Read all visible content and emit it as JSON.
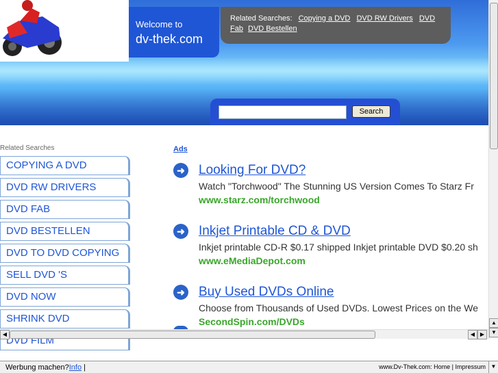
{
  "header": {
    "welcome_line1": "Welcome to",
    "welcome_line2": "dv-thek.com",
    "related_label": "Related Searches:",
    "related_links": [
      "Copying a DVD",
      "DVD RW Drivers",
      "DVD Fab",
      "DVD Bestellen"
    ],
    "search_button": "Search",
    "search_value": ""
  },
  "left": {
    "heading": "Related Searches",
    "items": [
      "COPYING A DVD",
      "DVD RW DRIVERS",
      "DVD FAB",
      "DVD BESTELLEN",
      "DVD TO DVD COPYING",
      "SELL DVD 'S",
      "DVD NOW",
      "SHRINK DVD",
      "DVD FILM"
    ]
  },
  "ads": {
    "label": "Ads",
    "items": [
      {
        "title": "Looking For DVD?",
        "desc": "Watch \"Torchwood\" The Stunning US Version Comes To Starz Fr",
        "url": "www.starz.com/torchwood"
      },
      {
        "title": "Inkjet Printable CD & DVD",
        "desc": "Inkjet printable CD-R $0.17 shipped Inkjet printable DVD $0.20 sh",
        "url": "www.eMediaDepot.com"
      },
      {
        "title": "Buy Used DVDs Online",
        "desc": "Choose from Thousands of Used DVDs. Lowest Prices on the We",
        "url": "SecondSpin.com/DVDs"
      }
    ]
  },
  "status": {
    "ad_text": "Werbung machen?",
    "info_link": "Info",
    "site": "www.Dv-Thek.com:",
    "home": "Home",
    "impressum": "Impressum"
  },
  "colors": {
    "brand_blue": "#1f56d6",
    "url_green": "#3aa62b",
    "related_box": "#5d5d5d"
  }
}
